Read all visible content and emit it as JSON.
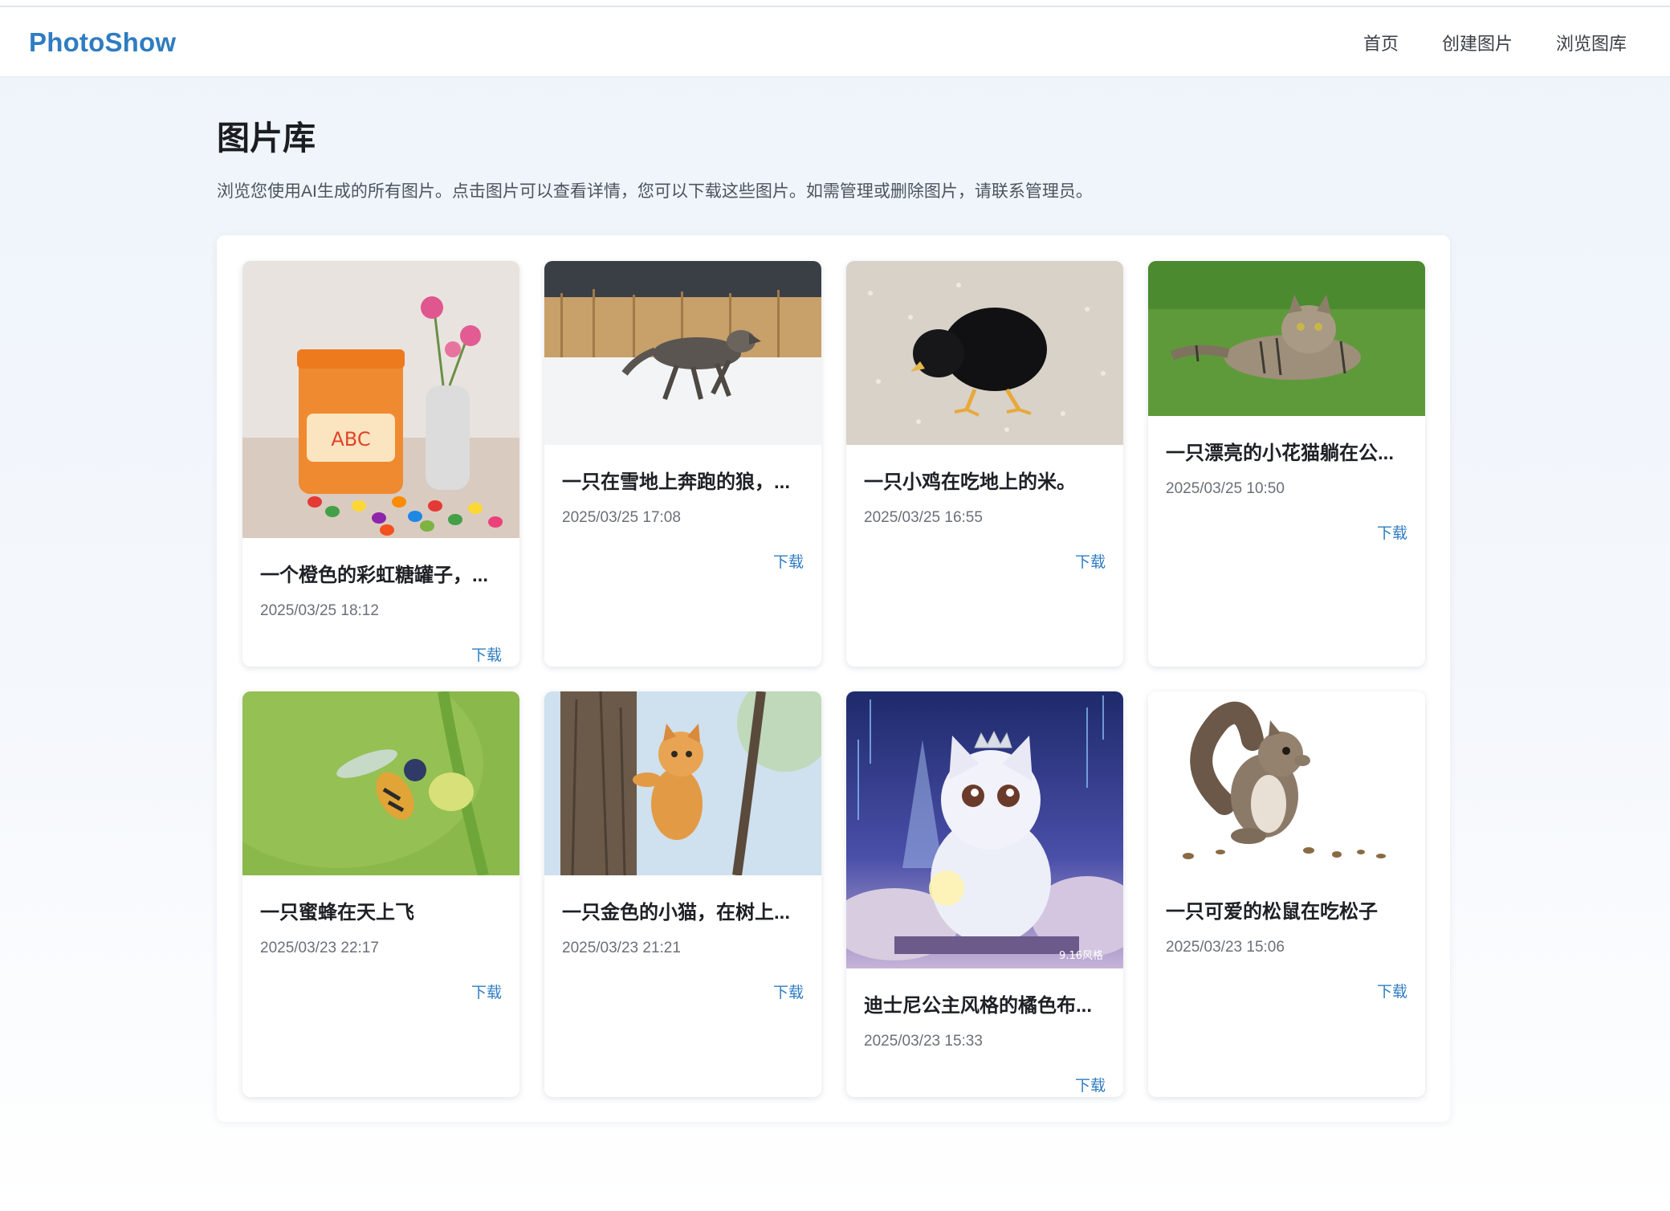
{
  "header": {
    "logo": "PhotoShow",
    "nav": [
      "首页",
      "创建图片",
      "浏览图库"
    ]
  },
  "page": {
    "title": "图片库",
    "description": "浏览您使用AI生成的所有图片。点击图片可以查看详情，您可以下载这些图片。如需管理或删除图片，请联系管理员。"
  },
  "gallery": {
    "download_label": "下载",
    "items": [
      {
        "title": "一个橙色的彩虹糖罐子，...",
        "date": "2025/03/25 18:12",
        "image": "candy-jar-image"
      },
      {
        "title": "一只在雪地上奔跑的狼，...",
        "date": "2025/03/25 17:08",
        "image": "wolf-snow-image"
      },
      {
        "title": "一只小鸡在吃地上的米。",
        "date": "2025/03/25 16:55",
        "image": "chick-rice-image"
      },
      {
        "title": "一只漂亮的小花猫躺在公...",
        "date": "2025/03/25 10:50",
        "image": "tabby-cat-image"
      },
      {
        "title": "一只蜜蜂在天上飞",
        "date": "2025/03/23 22:17",
        "image": "bee-image"
      },
      {
        "title": "一只金色的小猫，在树上...",
        "date": "2025/03/23 21:21",
        "image": "kitten-tree-image"
      },
      {
        "title": "迪士尼公主风格的橘色布...",
        "date": "2025/03/23 15:33",
        "image": "princess-cat-image",
        "watermark": "9.16风格"
      },
      {
        "title": "一只可爱的松鼠在吃松子",
        "date": "2025/03/23 15:06",
        "image": "squirrel-image"
      }
    ]
  }
}
